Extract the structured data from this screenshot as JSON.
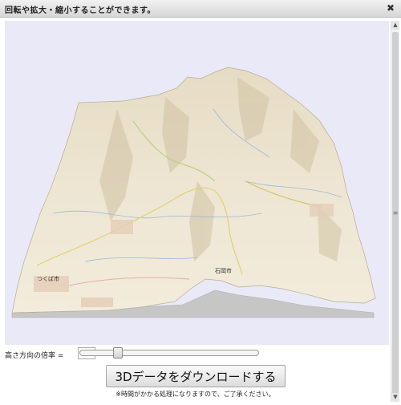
{
  "window": {
    "title": "回転や拡大・縮小することができます。",
    "close_symbol": "✖"
  },
  "map3d": {
    "place_labels": [
      "つくば市",
      "石岡市"
    ],
    "colors": {
      "background": "#e9e9f8",
      "terrain": "#efe7d2",
      "base": "#c9c9c9"
    }
  },
  "controls": {
    "height_label": "高さ方向の倍率 =",
    "height_value": "2.1",
    "slider_fraction": 0.2
  },
  "download": {
    "button_label": "3Dデータをダウンロードする",
    "note": "※時間がかかる処理になりますので、ご了承ください。"
  }
}
